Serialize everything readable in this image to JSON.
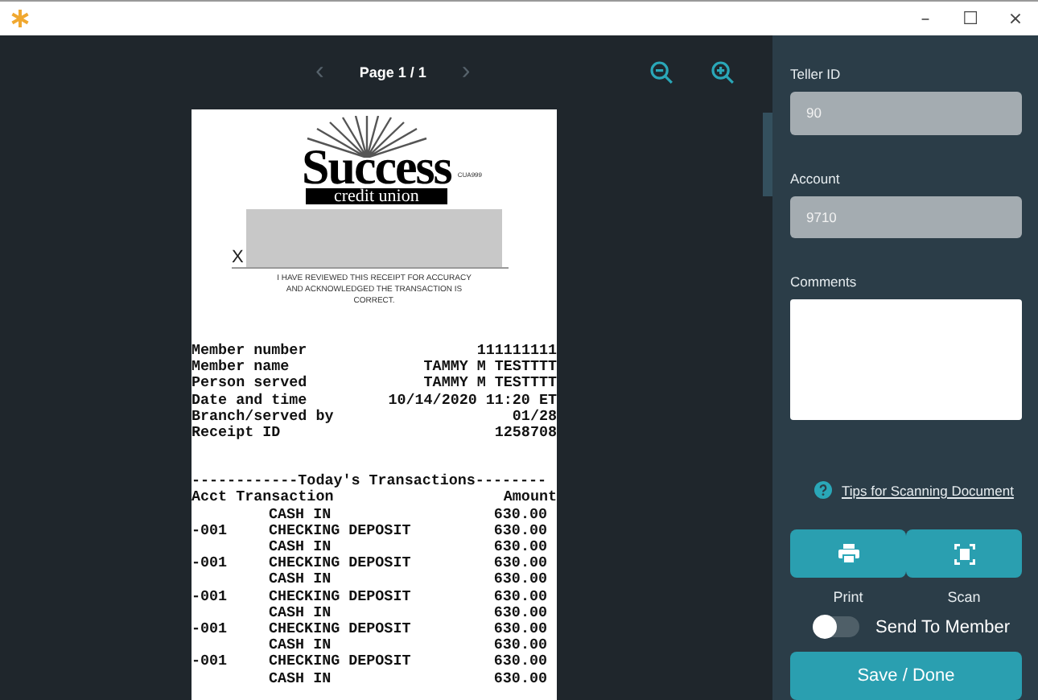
{
  "window": {
    "controls": [
      "–",
      "☐",
      "×"
    ]
  },
  "viewer": {
    "page_label": "Page 1 / 1",
    "prev": "‹",
    "next": "›"
  },
  "receipt": {
    "logo": {
      "name": "Success",
      "subtitle": "credit union",
      "code": "CUA999"
    },
    "signature_mark": "X",
    "disclaimer": "I HAVE REVIEWED THIS RECEIPT FOR ACCURACY AND ACKNOWLEDGED THE TRANSACTION IS CORRECT.",
    "info": [
      {
        "label": "Member number",
        "value": "111111111"
      },
      {
        "label": "Member name",
        "value": "TAMMY M TESTTTT"
      },
      {
        "label": "Person served",
        "value": "TAMMY M TESTTTT"
      },
      {
        "label": "Date and time",
        "value": "10/14/2020 11:20 ET"
      },
      {
        "label": "Branch/served by",
        "value": "01/28"
      },
      {
        "label": "Receipt ID",
        "value": "1258708"
      }
    ],
    "transactions_heading": "------------Today's Transactions--------",
    "columns": [
      "Acct Transaction",
      "Amount"
    ],
    "rows": [
      {
        "acct": "",
        "transaction": "CASH IN",
        "amount": "630.00"
      },
      {
        "acct": "-001",
        "transaction": "CHECKING DEPOSIT",
        "amount": "630.00"
      },
      {
        "acct": "",
        "transaction": "CASH IN",
        "amount": "630.00"
      },
      {
        "acct": "-001",
        "transaction": "CHECKING DEPOSIT",
        "amount": "630.00"
      },
      {
        "acct": "",
        "transaction": "CASH IN",
        "amount": "630.00"
      },
      {
        "acct": "-001",
        "transaction": "CHECKING DEPOSIT",
        "amount": "630.00"
      },
      {
        "acct": "",
        "transaction": "CASH IN",
        "amount": "630.00"
      },
      {
        "acct": "-001",
        "transaction": "CHECKING DEPOSIT",
        "amount": "630.00"
      },
      {
        "acct": "",
        "transaction": "CASH IN",
        "amount": "630.00"
      },
      {
        "acct": "-001",
        "transaction": "CHECKING DEPOSIT",
        "amount": "630.00"
      },
      {
        "acct": "",
        "transaction": "CASH IN",
        "amount": "630.00"
      }
    ]
  },
  "form": {
    "teller_id": {
      "label": "Teller ID",
      "value": "90"
    },
    "account": {
      "label": "Account",
      "value": "9710"
    },
    "comments": {
      "label": "Comments"
    },
    "tips_link": "Tips for Scanning Document",
    "actions": [
      {
        "kind": "print",
        "label": "Print"
      },
      {
        "kind": "scan",
        "label": "Scan"
      }
    ],
    "send_to_member": {
      "label": "Send To Member",
      "on": false
    },
    "save_button": "Save / Done"
  }
}
